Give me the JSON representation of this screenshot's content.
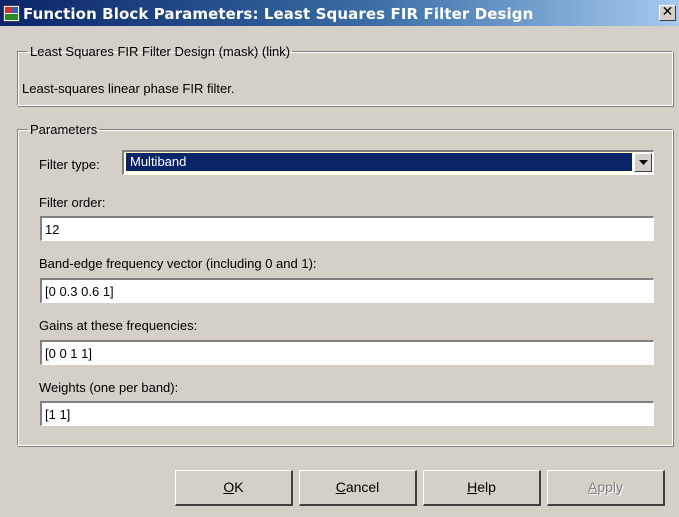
{
  "window": {
    "title": "Function Block Parameters: Least Squares FIR Filter Design",
    "close_glyph": "✕",
    "icon": "simulink-block-icon"
  },
  "description": {
    "group_label": "Least Squares FIR Filter Design (mask) (link)",
    "text": "Least-squares linear phase FIR filter."
  },
  "parameters": {
    "group_label": "Parameters",
    "filter_type": {
      "label": "Filter type:",
      "value": "Multiband"
    },
    "filter_order": {
      "label": "Filter order:",
      "value": "12"
    },
    "band_edge": {
      "label": "Band-edge frequency vector (including 0 and 1):",
      "value": "[0 0.3 0.6 1]"
    },
    "gains": {
      "label": "Gains at these frequencies:",
      "value": "[0 0 1 1]"
    },
    "weights": {
      "label": "Weights (one per band):",
      "value": "[1 1]"
    }
  },
  "buttons": {
    "ok": {
      "mnemonic": "O",
      "rest": "K"
    },
    "cancel": {
      "mnemonic": "C",
      "rest": "ancel"
    },
    "help": {
      "mnemonic": "H",
      "rest": "elp"
    },
    "apply": {
      "mnemonic": "A",
      "rest": "pply",
      "enabled": false
    }
  }
}
